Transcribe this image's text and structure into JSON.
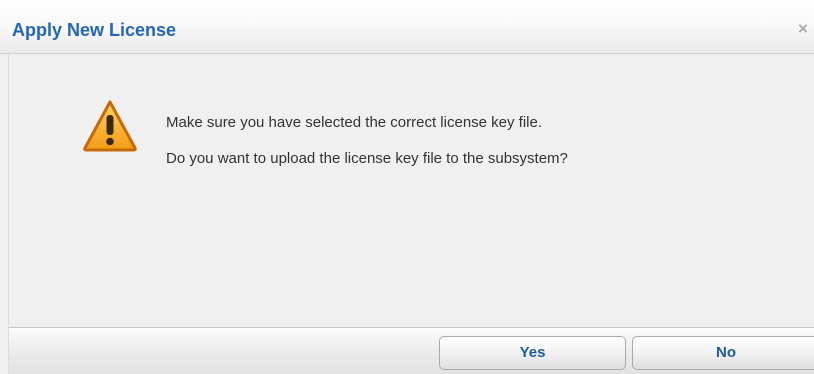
{
  "dialog": {
    "title": "Apply New License",
    "close_label": "×",
    "icon": "warning-triangle-icon",
    "messages": [
      "Make sure you have selected the correct license key file.",
      "Do you want to upload the license key file to the subsystem?"
    ],
    "buttons": {
      "yes_label": "Yes",
      "no_label": "No"
    }
  },
  "colors": {
    "title": "#2266bb",
    "button_text": "#1f5a9e",
    "warning_fill": "#f5a623",
    "warning_stroke": "#c56a0a",
    "background": "#f0f0f0"
  }
}
